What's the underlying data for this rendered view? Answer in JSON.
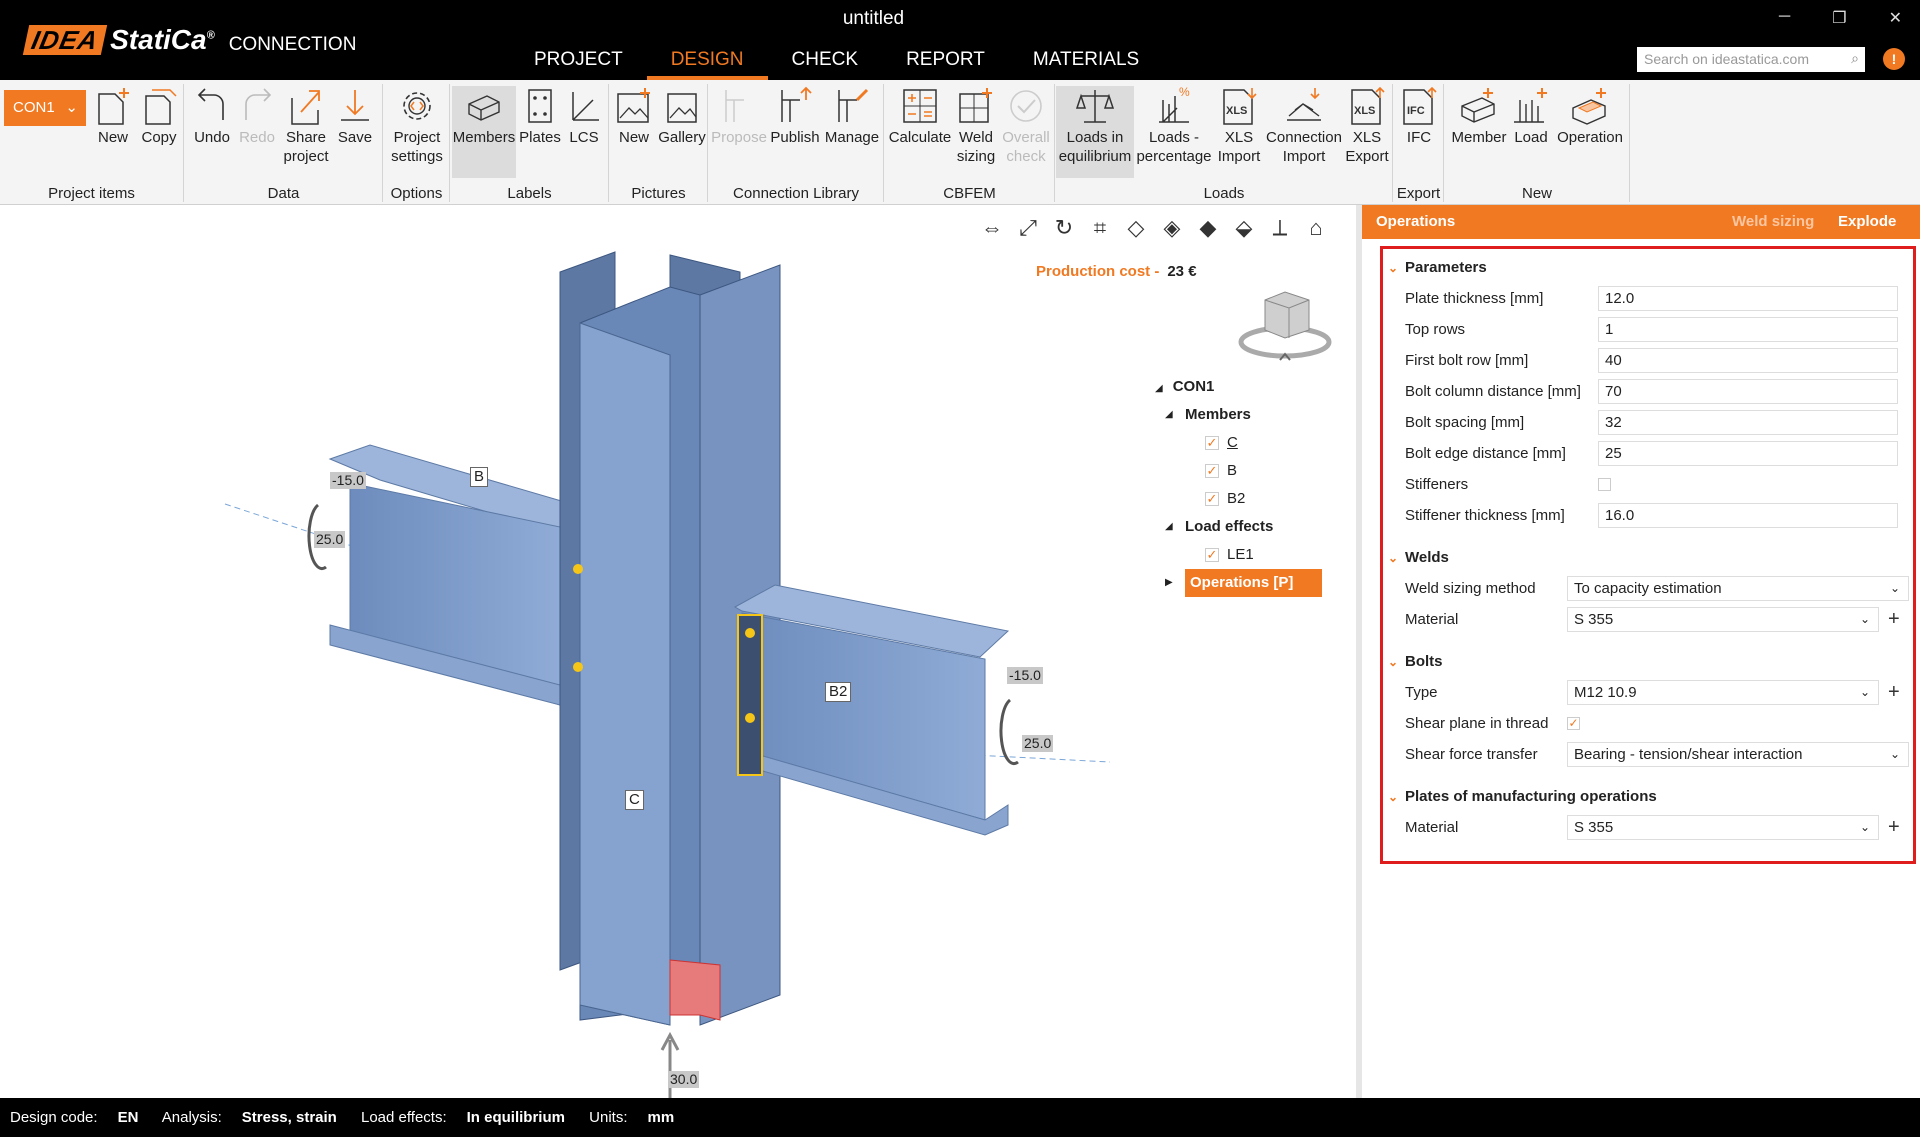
{
  "titlebar": {
    "logo_idea": "IDEA",
    "logo_statica": "StatiCa",
    "logo_reg": "®",
    "product": "CONNECTION",
    "window_title": "untitled",
    "minimize": "─",
    "maximize": "❐",
    "close": "✕",
    "search_placeholder": "Search on ideastatica.com",
    "info": "!"
  },
  "tabs": [
    "PROJECT",
    "DESIGN",
    "CHECK",
    "REPORT",
    "MATERIALS"
  ],
  "ribbon": {
    "con": "CON1",
    "project_items": {
      "label": "Project items",
      "new": "New",
      "copy": "Copy"
    },
    "data": {
      "label": "Data",
      "undo": "Undo",
      "redo": "Redo",
      "share": "Share project",
      "save": "Save"
    },
    "options": {
      "label": "Options",
      "settings": "Project settings"
    },
    "labels": {
      "label": "Labels",
      "members": "Members",
      "plates": "Plates",
      "lcs": "LCS"
    },
    "pictures": {
      "label": "Pictures",
      "new": "New",
      "gallery": "Gallery"
    },
    "library": {
      "label": "Connection Library",
      "propose": "Propose",
      "publish": "Publish",
      "manage": "Manage"
    },
    "cbfem": {
      "label": "CBFEM",
      "calculate": "Calculate",
      "weld": "Weld sizing",
      "overall": "Overall check"
    },
    "loads": {
      "label": "Loads",
      "equil": "Loads in equilibrium",
      "percent": "Loads - percentage",
      "xls_import": "XLS Import",
      "conn_import": "Connection Import",
      "xls_export": "XLS Export",
      "xls": "XLS"
    },
    "export": {
      "label": "Export",
      "ifc": "IFC"
    },
    "new": {
      "label": "New",
      "member": "Member",
      "load": "Load",
      "operation": "Operation"
    }
  },
  "viewport": {
    "production_label": "Production cost",
    "production_sep": "-",
    "production_value": "23 €",
    "labels": {
      "b": "B",
      "b2": "B2",
      "c": "C"
    },
    "dims": {
      "d1": "-15.0",
      "d2": "25.0",
      "d3": "-15.0",
      "d4": "25.0",
      "d5": "30.0"
    }
  },
  "tree": {
    "root": "CON1",
    "members": "Members",
    "m1": "C",
    "m2": "B",
    "m3": "B2",
    "loads": "Load effects",
    "le1": "LE1",
    "ops": "Operations [P]"
  },
  "panel": {
    "title": "Operations",
    "weld_sizing": "Weld sizing",
    "explode": "Explode",
    "parameters": {
      "title": "Parameters",
      "plate_thickness_label": "Plate thickness [mm]",
      "plate_thickness": "12.0",
      "top_rows_label": "Top rows",
      "top_rows": "1",
      "first_bolt_label": "First bolt row [mm]",
      "first_bolt": "40",
      "bolt_col_label": "Bolt column distance [mm]",
      "bolt_col": "70",
      "bolt_spacing_label": "Bolt spacing [mm]",
      "bolt_spacing": "32",
      "bolt_edge_label": "Bolt edge distance [mm]",
      "bolt_edge": "25",
      "stiffeners_label": "Stiffeners",
      "stiff_thk_label": "Stiffener thickness [mm]",
      "stiff_thk": "16.0"
    },
    "welds": {
      "title": "Welds",
      "method_label": "Weld sizing method",
      "method": "To capacity estimation",
      "material_label": "Material",
      "material": "S 355"
    },
    "bolts": {
      "title": "Bolts",
      "type_label": "Type",
      "type": "M12 10.9",
      "shear_plane_label": "Shear plane in thread",
      "shear_force_label": "Shear force transfer",
      "shear_force": "Bearing - tension/shear interaction"
    },
    "plates": {
      "title": "Plates of manufacturing operations",
      "material_label": "Material",
      "material": "S 355"
    }
  },
  "status": {
    "code_label": "Design code:",
    "code": "EN",
    "analysis_label": "Analysis:",
    "analysis": "Stress, strain",
    "loads_label": "Load effects:",
    "loads": "In equilibrium",
    "units_label": "Units:",
    "units": "mm"
  },
  "colors": {
    "accent": "#f07922",
    "steel": "#7f9cc8",
    "highlight": "#e01d1d"
  }
}
